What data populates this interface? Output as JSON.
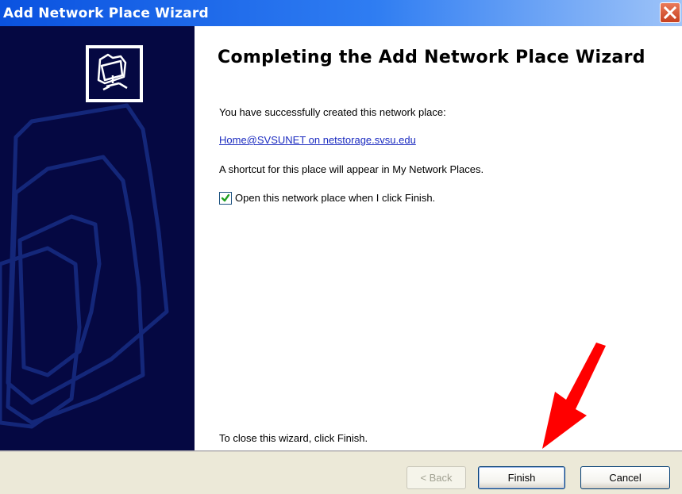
{
  "window": {
    "title": "Add Network Place Wizard"
  },
  "content": {
    "heading": "Completing the Add Network Place Wizard",
    "success_text": "You have successfully created this network place:",
    "network_place_link": "Home@SVSUNET on netstorage.svsu.edu",
    "shortcut_text": "A shortcut for this place will appear in My Network Places.",
    "open_checkbox": {
      "label": "Open this network place when I click Finish.",
      "checked": true
    },
    "close_instruction": "To close this wizard, click Finish."
  },
  "buttons": {
    "back_label": "< Back",
    "finish_label": "Finish",
    "cancel_label": "Cancel"
  },
  "icons": {
    "close": "close-icon",
    "wizard": "network-folder-icon",
    "annotation": "red-arrow-icon"
  },
  "colors": {
    "title_bar": "#0a52e0",
    "side_panel": "#050842",
    "link": "#1b2bc0",
    "annotation_arrow": "#ff0000"
  }
}
